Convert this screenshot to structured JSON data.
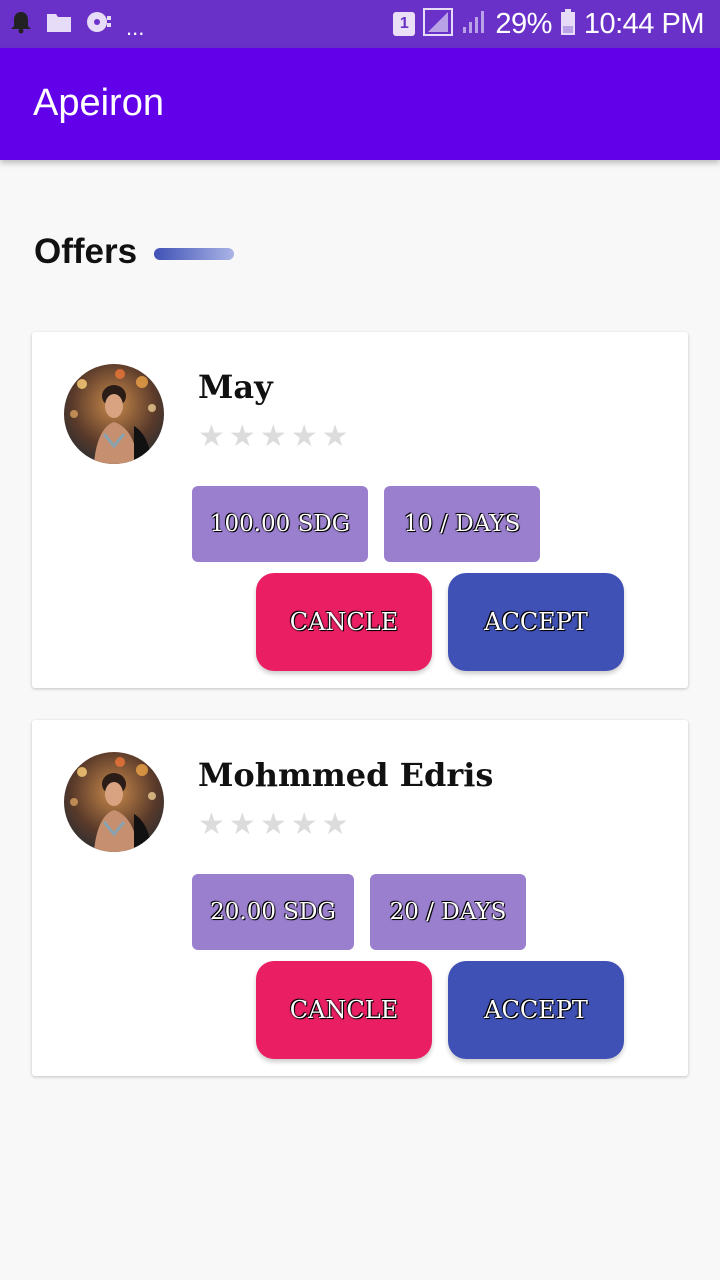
{
  "status_bar": {
    "sim_label": "1",
    "battery": "29%",
    "time": "10:44 PM",
    "more": "..."
  },
  "app_bar": {
    "title": "Apeiron"
  },
  "section": {
    "title": "Offers"
  },
  "colors": {
    "status_bar": "#6a31c8",
    "app_bar": "#6200ea",
    "tag": "#9b7fcf",
    "cancel": "#e91e63",
    "accept": "#3f51b5",
    "star_empty": "#dcdcdc"
  },
  "offers": [
    {
      "name": "May",
      "rating": 0,
      "max_rating": 5,
      "price": "100.00 SDG",
      "duration": "10 / DAYS",
      "cancel_label": "CANCLE",
      "accept_label": "ACCEPT"
    },
    {
      "name": "Mohmmed Edris",
      "rating": 0,
      "max_rating": 5,
      "price": "20.00 SDG",
      "duration": "20 / DAYS",
      "cancel_label": "CANCLE",
      "accept_label": "ACCEPT"
    }
  ]
}
